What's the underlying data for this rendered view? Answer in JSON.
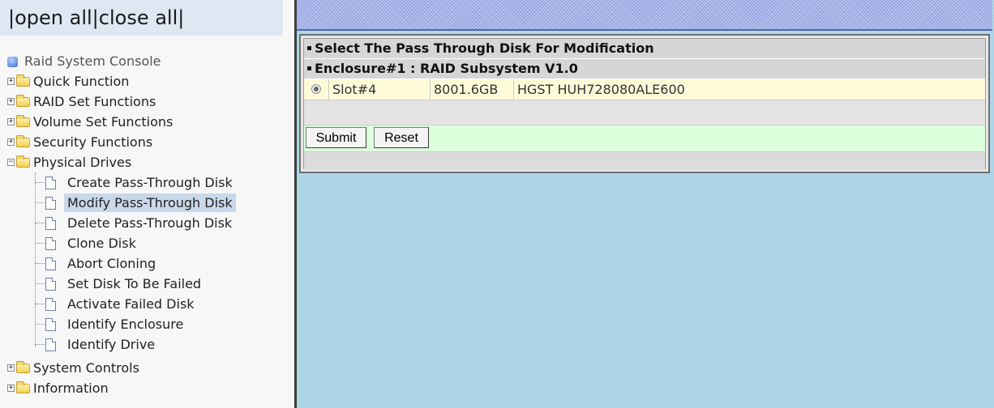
{
  "nav": {
    "open_all": "open all",
    "close_all": "close all",
    "sep": "|"
  },
  "tree": {
    "root": "Raid System Console",
    "folders": {
      "quick": "Quick Function",
      "raid_set": "RAID Set Functions",
      "volume_set": "Volume Set Functions",
      "security": "Security Functions",
      "physical": "Physical Drives",
      "system": "System Controls",
      "information": "Information"
    },
    "physical_items": [
      "Create Pass-Through Disk",
      "Modify Pass-Through Disk",
      "Delete Pass-Through Disk",
      "Clone Disk",
      "Abort Cloning",
      "Set Disk To Be Failed",
      "Activate Failed Disk",
      "Identify Enclosure",
      "Identify Drive"
    ],
    "selected_item": "Modify Pass-Through Disk"
  },
  "main": {
    "title": "Select The Pass Through Disk For Modification",
    "enclosure": "Enclosure#1 : RAID Subsystem V1.0",
    "disk": {
      "slot": "Slot#4",
      "capacity": "8001.6GB",
      "model": "HGST HUH728080ALE600",
      "selected": true
    },
    "submit_label": "Submit",
    "reset_label": "Reset"
  },
  "colors": {
    "selected_bg": "#c9d8ea",
    "header_bg": "#d6d6d6",
    "disk_row_bg": "#fffbd9",
    "button_row_bg": "#dcffdc",
    "content_bg": "#aed6e6"
  }
}
